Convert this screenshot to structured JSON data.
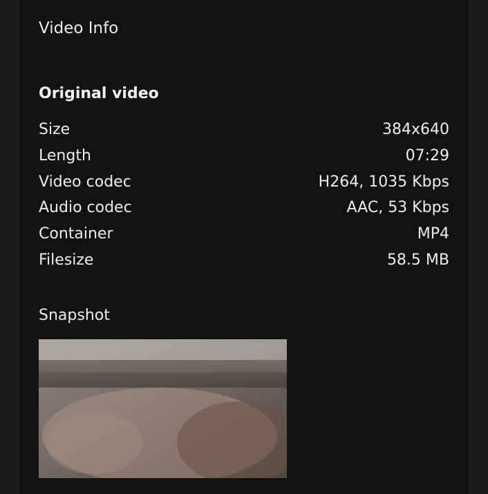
{
  "panel": {
    "title": "Video Info"
  },
  "original_video": {
    "heading": "Original video",
    "rows": [
      {
        "label": "Size",
        "value": "384x640"
      },
      {
        "label": "Length",
        "value": "07:29"
      },
      {
        "label": "Video codec",
        "value": "H264, 1035 Kbps"
      },
      {
        "label": "Audio codec",
        "value": "AAC, 53 Kbps"
      },
      {
        "label": "Container",
        "value": "MP4"
      },
      {
        "label": "Filesize",
        "value": "58.5 MB"
      }
    ]
  },
  "snapshot": {
    "heading": "Snapshot"
  }
}
